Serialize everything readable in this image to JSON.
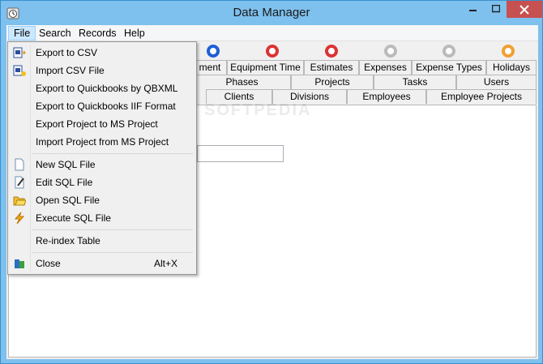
{
  "window": {
    "title": "Data Manager"
  },
  "menubar": {
    "file": "File",
    "search": "Search",
    "records": "Records",
    "help": "Help"
  },
  "toolbar": {
    "buttons": [
      {
        "icon": "nav-next-icon",
        "color": "#1f5fd6"
      },
      {
        "icon": "add-record-icon",
        "color": "#d33"
      },
      {
        "icon": "delete-record-icon",
        "color": "#d33"
      },
      {
        "icon": "disabled-icon",
        "color": "#bbbbbb"
      },
      {
        "icon": "cancel-icon",
        "color": "#bbbbbb"
      },
      {
        "icon": "refresh-icon",
        "color": "#f0a030"
      }
    ]
  },
  "tabs": {
    "row1": [
      "ment",
      "Equipment Time",
      "Estimates",
      "Expenses",
      "Expense Types",
      "Holidays"
    ],
    "row2": [
      "Phases",
      "Projects",
      "Tasks",
      "Users"
    ],
    "row3": [
      "Clients",
      "Divisions",
      "Employees",
      "Employee Projects"
    ]
  },
  "watermark": "SOFTPEDIA",
  "file_menu": {
    "items": [
      {
        "label": "Export to CSV",
        "icon": "export-csv-icon"
      },
      {
        "label": "Import CSV File",
        "icon": "import-csv-icon"
      },
      {
        "label": "Export to Quickbooks by QBXML",
        "icon": ""
      },
      {
        "label": "Export to Quickbooks IIF Format",
        "icon": ""
      },
      {
        "label": "Export Project to MS Project",
        "icon": ""
      },
      {
        "label": "Import Project from MS Project",
        "icon": ""
      },
      {
        "label": "New SQL File",
        "icon": "new-file-icon"
      },
      {
        "label": "Edit SQL File",
        "icon": "edit-file-icon"
      },
      {
        "label": "Open SQL File",
        "icon": "open-folder-icon"
      },
      {
        "label": "Execute SQL File",
        "icon": "lightning-icon"
      },
      {
        "label": "Re-index Table",
        "icon": ""
      },
      {
        "label": "Close",
        "icon": "exit-icon",
        "shortcut": "Alt+X"
      }
    ]
  }
}
